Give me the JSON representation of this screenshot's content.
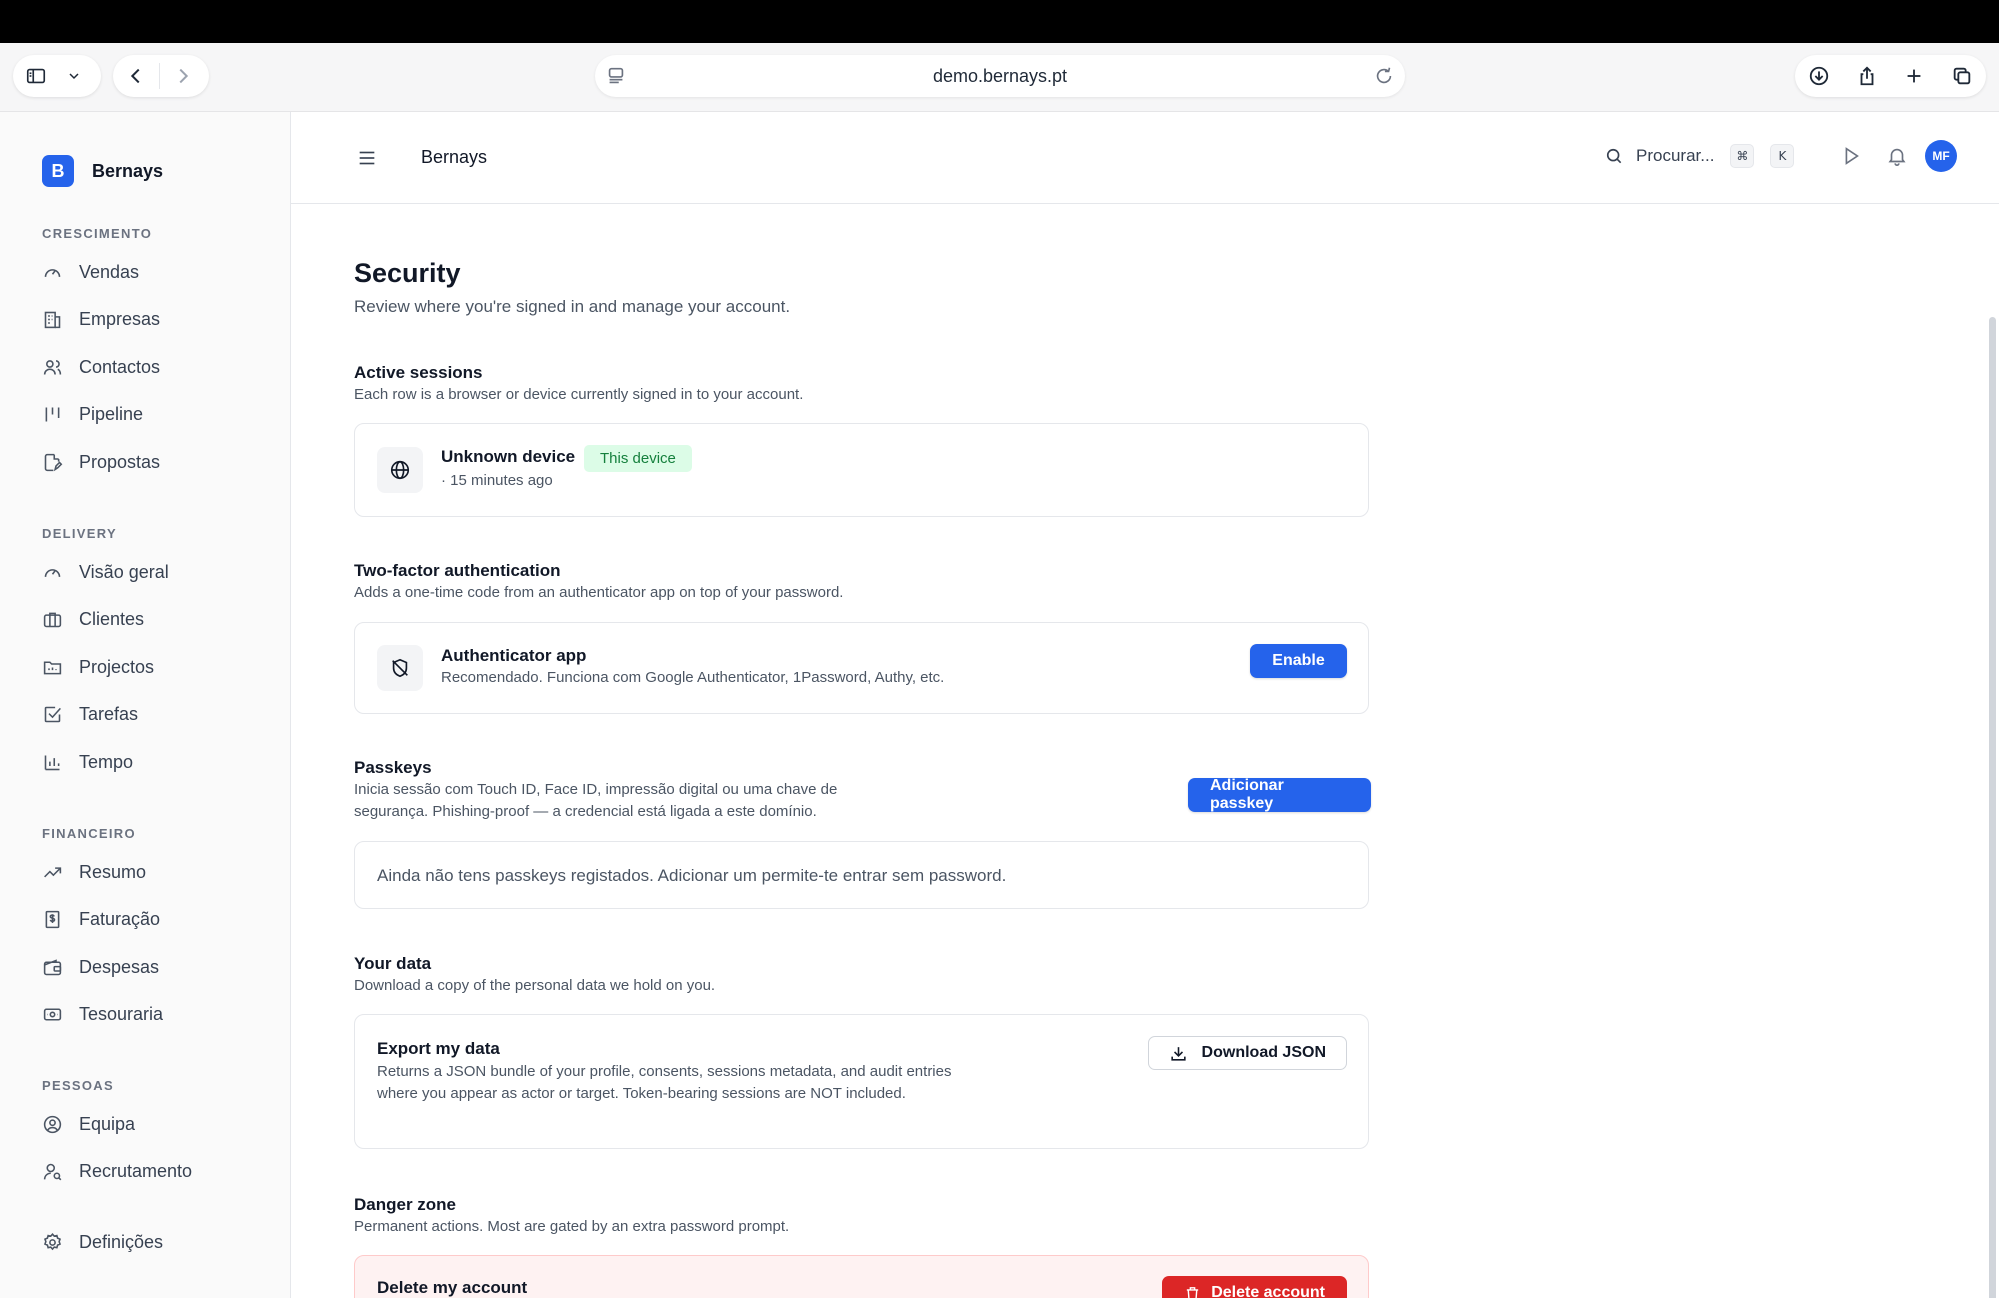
{
  "browser": {
    "url": "demo.bernays.pt"
  },
  "app": {
    "brand_initial": "B",
    "brand_name": "Bernays",
    "accent": "#2563eb"
  },
  "sidebar": {
    "sections": [
      {
        "label": "CRESCIMENTO",
        "items": [
          "Vendas",
          "Empresas",
          "Contactos",
          "Pipeline",
          "Propostas"
        ]
      },
      {
        "label": "DELIVERY",
        "items": [
          "Visão geral",
          "Clientes",
          "Projectos",
          "Tarefas",
          "Tempo"
        ]
      },
      {
        "label": "FINANCEIRO",
        "items": [
          "Resumo",
          "Faturação",
          "Despesas",
          "Tesouraria"
        ]
      },
      {
        "label": "PESSOAS",
        "items": [
          "Equipa",
          "Recrutamento"
        ]
      }
    ],
    "settings": "Definições"
  },
  "header": {
    "title": "Bernays",
    "search_placeholder": "Procurar...",
    "kbd_cmd": "⌘",
    "kbd_k": "K",
    "avatar_initials": "MF"
  },
  "page": {
    "title": "Security",
    "subtitle": "Review where you're signed in and manage your account."
  },
  "sessions": {
    "title": "Active sessions",
    "description": "Each row is a browser or device currently signed in to your account.",
    "items": [
      {
        "device": "Unknown device",
        "badge": "This device",
        "time": "· 15 minutes ago"
      }
    ]
  },
  "two_factor": {
    "title": "Two-factor authentication",
    "description": "Adds a one-time code from an authenticator app on top of your password.",
    "app_title": "Authenticator app",
    "app_sub": "Recomendado. Funciona com Google Authenticator, 1Password, Authy, etc.",
    "enable_label": "Enable"
  },
  "passkeys": {
    "title": "Passkeys",
    "description_line1": "Inicia sessão com Touch ID, Face ID, impressão digital ou uma chave de",
    "description_line2": "segurança. Phishing-proof — a credencial está ligada a este domínio.",
    "add_label": "Adicionar passkey",
    "empty": "Ainda não tens passkeys registados. Adicionar um permite-te entrar sem password."
  },
  "your_data": {
    "title": "Your data",
    "description": "Download a copy of the personal data we hold on you.",
    "export_title": "Export my data",
    "export_desc": "Returns a JSON bundle of your profile, consents, sessions metadata, and audit entries where you appear as actor or target. Token-bearing sessions are NOT included.",
    "download_label": "Download JSON"
  },
  "danger": {
    "title": "Danger zone",
    "description": "Permanent actions. Most are gated by an extra password prompt.",
    "delete_title": "Delete my account",
    "delete_label": "Delete account"
  }
}
